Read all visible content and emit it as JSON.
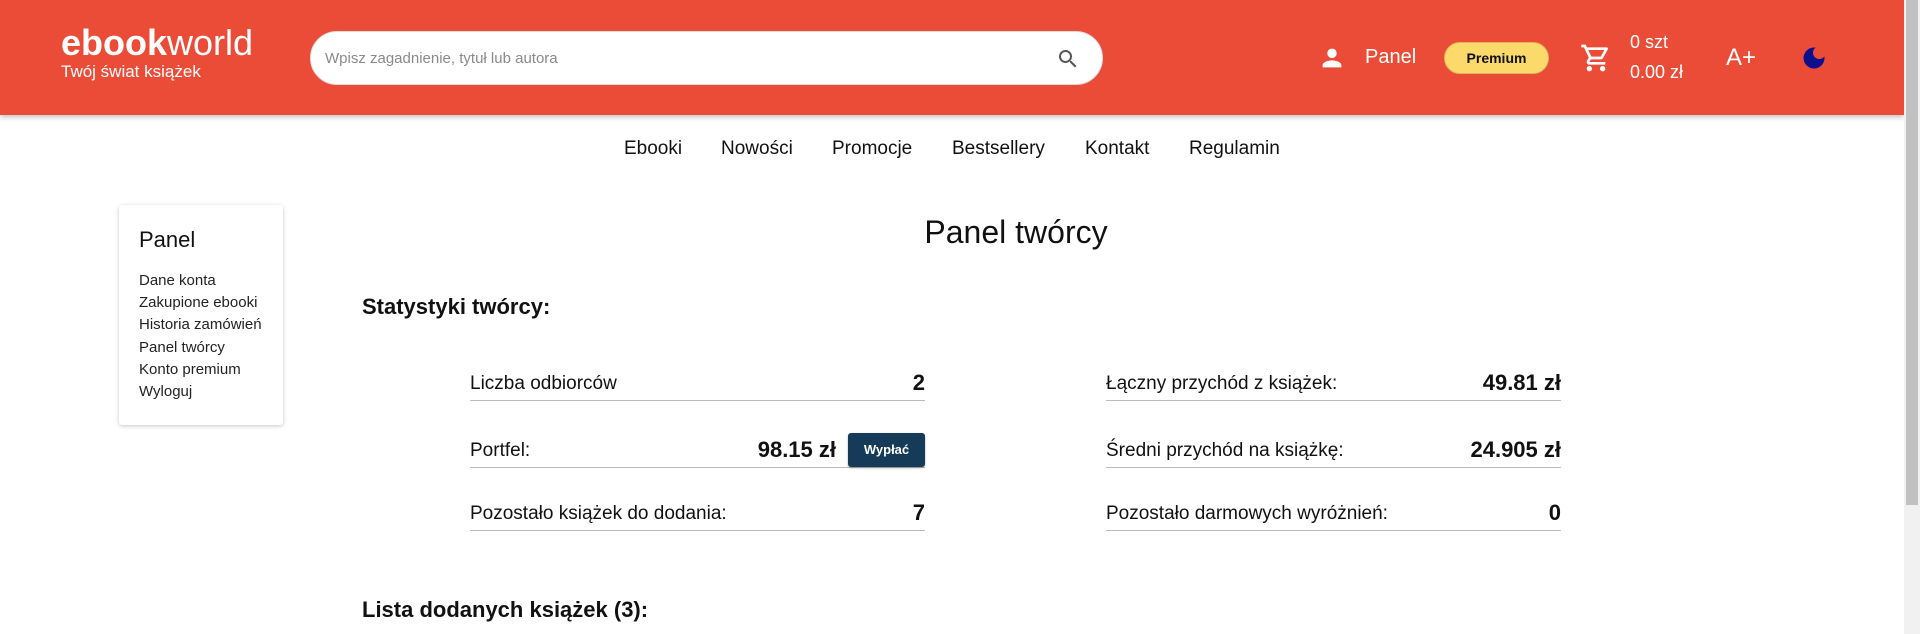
{
  "header": {
    "logo_bold": "ebook",
    "logo_light": "world",
    "tagline": "Twój świat książek",
    "search_placeholder": "Wpisz zagadnienie, tytuł lub autora",
    "panel_label": "Panel",
    "premium_label": "Premium",
    "cart_count": "0 szt",
    "cart_total": "0.00 zł",
    "font_size_label": "A+",
    "colors": {
      "bar": "#eb4c38",
      "premium": "#fcd96b",
      "moon": "#0d0f8c"
    }
  },
  "nav": {
    "items": [
      "Ebooki",
      "Nowości",
      "Promocje",
      "Bestsellery",
      "Kontakt",
      "Regulamin"
    ]
  },
  "sidebar": {
    "title": "Panel",
    "items": [
      "Dane konta",
      "Zakupione ebooki",
      "Historia zamówień",
      "Panel twórcy",
      "Konto premium",
      "Wyloguj"
    ]
  },
  "main": {
    "title": "Panel twórcy",
    "stats_heading": "Statystyki twórcy:",
    "stats_left": [
      {
        "label": "Liczba odbiorców",
        "value": "2"
      },
      {
        "label": "Portfel:",
        "value": "98.15 zł",
        "action": "Wypłać"
      },
      {
        "label": "Pozostało książek do dodania:",
        "value": "7"
      }
    ],
    "stats_right": [
      {
        "label": "Łączny przychód z książek:",
        "value": "49.81 zł"
      },
      {
        "label": "Średni przychód na książkę:",
        "value": "24.905 zł"
      },
      {
        "label": "Pozostało darmowych wyróżnień:",
        "value": "0"
      }
    ],
    "books_heading": "Lista dodanych książek (3):"
  }
}
